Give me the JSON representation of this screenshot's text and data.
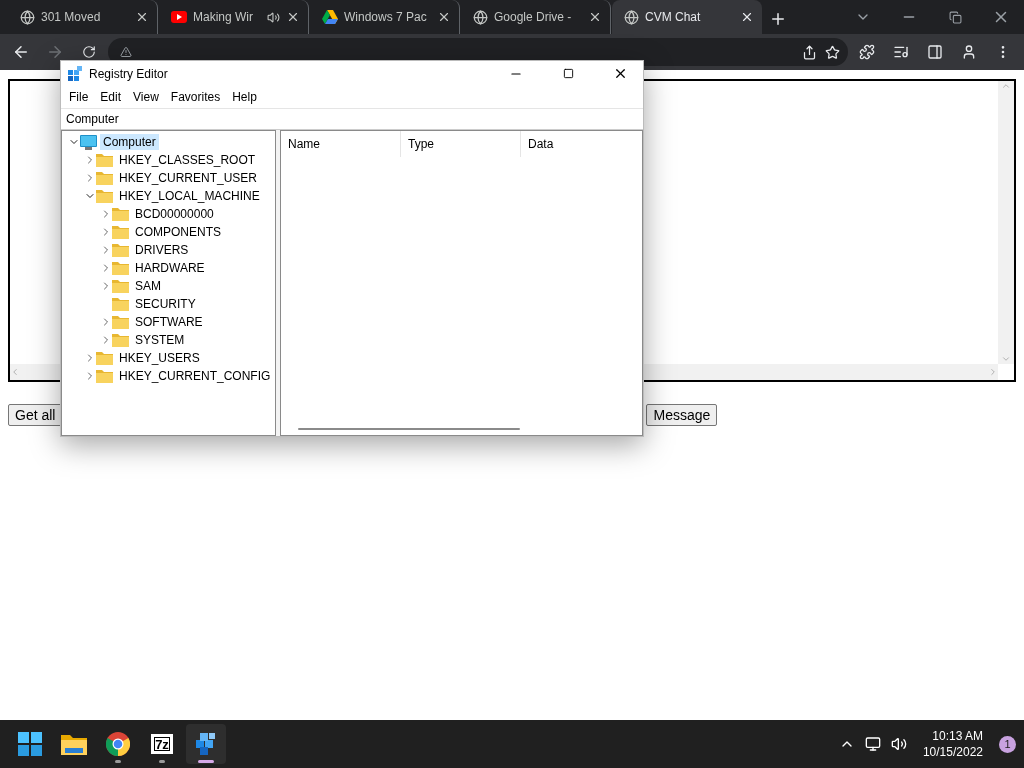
{
  "browser": {
    "tabs": [
      {
        "title": "301 Moved",
        "kind": "globe",
        "audio": false,
        "selected": false
      },
      {
        "title": "Making Wir",
        "kind": "youtube",
        "audio": true,
        "selected": false
      },
      {
        "title": "Windows 7 Pac",
        "kind": "drive",
        "audio": false,
        "selected": false
      },
      {
        "title": "Google Drive -",
        "kind": "globe",
        "audio": false,
        "selected": false
      },
      {
        "title": "CVM Chat",
        "kind": "globe",
        "audio": false,
        "selected": true
      }
    ],
    "secure": false
  },
  "page": {
    "buttons": [
      {
        "label": "Get all"
      },
      {
        "label": "Message"
      }
    ]
  },
  "registry": {
    "title": "Registry Editor",
    "menu": [
      "File",
      "Edit",
      "View",
      "Favorites",
      "Help"
    ],
    "address": "Computer",
    "columns": [
      "Name",
      "Type",
      "Data"
    ],
    "tree": [
      {
        "label": "Computer",
        "kind": "computer",
        "selected": true,
        "expandable": true,
        "expanded": true,
        "children": [
          {
            "label": "HKEY_CLASSES_ROOT",
            "kind": "folder",
            "selected": false,
            "expandable": true,
            "expanded": false
          },
          {
            "label": "HKEY_CURRENT_USER",
            "kind": "folder",
            "selected": false,
            "expandable": true,
            "expanded": false
          },
          {
            "label": "HKEY_LOCAL_MACHINE",
            "kind": "folder",
            "selected": false,
            "expandable": true,
            "expanded": true,
            "children": [
              {
                "label": "BCD00000000",
                "kind": "folder",
                "selected": false,
                "expandable": true
              },
              {
                "label": "COMPONENTS",
                "kind": "folder",
                "selected": false,
                "expandable": true
              },
              {
                "label": "DRIVERS",
                "kind": "folder",
                "selected": false,
                "expandable": true
              },
              {
                "label": "HARDWARE",
                "kind": "folder",
                "selected": false,
                "expandable": true
              },
              {
                "label": "SAM",
                "kind": "folder",
                "selected": false,
                "expandable": true
              },
              {
                "label": "SECURITY",
                "kind": "folder",
                "selected": false,
                "expandable": false
              },
              {
                "label": "SOFTWARE",
                "kind": "folder",
                "selected": false,
                "expandable": true
              },
              {
                "label": "SYSTEM",
                "kind": "folder",
                "selected": false,
                "expandable": true
              }
            ]
          },
          {
            "label": "HKEY_USERS",
            "kind": "folder",
            "selected": false,
            "expandable": true,
            "expanded": false
          },
          {
            "label": "HKEY_CURRENT_CONFIG",
            "kind": "folder",
            "selected": false,
            "expandable": true,
            "expanded": false
          }
        ]
      }
    ]
  },
  "taskbar": {
    "apps": [
      {
        "kind": "start",
        "running": false,
        "selected": false
      },
      {
        "kind": "explorer",
        "running": false,
        "selected": false
      },
      {
        "kind": "chrome",
        "running": true,
        "selected": false
      },
      {
        "kind": "sevenzip",
        "label": "7z",
        "running": true,
        "selected": false
      },
      {
        "kind": "regedit",
        "running": true,
        "selected": true
      }
    ],
    "time": "10:13 AM",
    "date": "10/15/2022",
    "notifications": "1"
  }
}
